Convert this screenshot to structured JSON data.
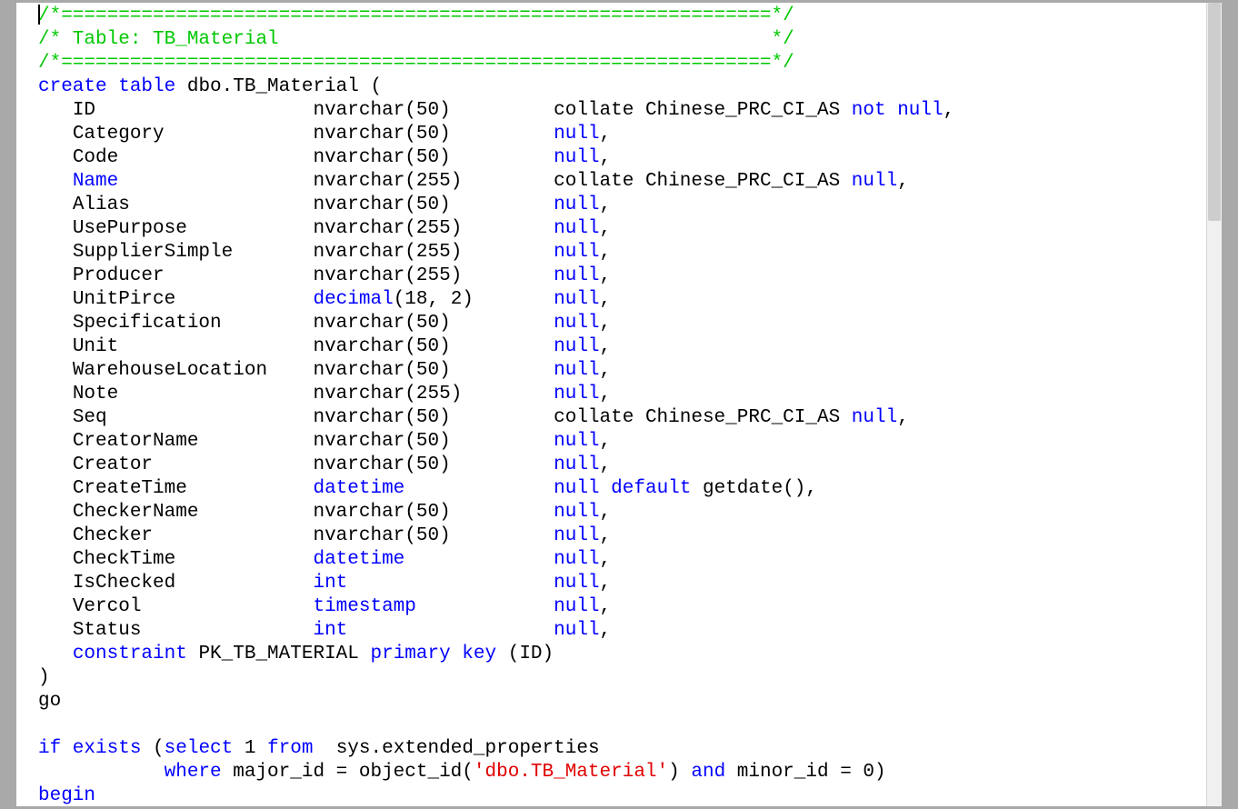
{
  "comment_bar": "/*==============================================================*/",
  "comment_title": "/* Table: TB_Material                                           */",
  "create_prefix": "create table",
  "create_name": " dbo.TB_Material (",
  "collate_text": "collate Chinese_PRC_CI_AS ",
  "kw_null": "null",
  "kw_notnull": "not null",
  "kw_default": "default",
  "kw_constraint": "constraint",
  "kw_pk": "primary key",
  "kw_decimal": "decimal",
  "kw_datetime": "datetime",
  "kw_int": "int",
  "kw_timestamp": "timestamp",
  "close_paren": ")",
  "go": "go",
  "if_exists_prefix": "if exists",
  "if_exists_mid1": " (",
  "kw_select": "select",
  "select_mid": " 1 ",
  "kw_from": "from",
  "from_trail": "  sys.extended_properties",
  "kw_where": "where",
  "where_mid": " major_id = object_id(",
  "str_dbo": "'dbo.TB_Material'",
  "where_trail1": ") ",
  "kw_and": "and",
  "where_trail2": " minor_id = 0)",
  "kw_begin": "begin",
  "getdate_trail": " getdate(),",
  "pk_name": " PK_TB_MATERIAL ",
  "pk_trail": " (ID)",
  "columns": [
    {
      "name": "ID",
      "type": "nvarchar(50)",
      "collate": true,
      "nullable": "not null",
      "comma": ","
    },
    {
      "name": "Category",
      "type": "nvarchar(50)",
      "collate": false,
      "nullable": "null",
      "comma": ","
    },
    {
      "name": "Code",
      "type": "nvarchar(50)",
      "collate": false,
      "nullable": "null",
      "comma": ","
    },
    {
      "name": "Name",
      "type": "nvarchar(255)",
      "collate": true,
      "nullable": "null",
      "comma": ",",
      "name_kw": true
    },
    {
      "name": "Alias",
      "type": "nvarchar(50)",
      "collate": false,
      "nullable": "null",
      "comma": ","
    },
    {
      "name": "UsePurpose",
      "type": "nvarchar(255)",
      "collate": false,
      "nullable": "null",
      "comma": ","
    },
    {
      "name": "SupplierSimple",
      "type": "nvarchar(255)",
      "collate": false,
      "nullable": "null",
      "comma": ","
    },
    {
      "name": "Producer",
      "type": "nvarchar(255)",
      "collate": false,
      "nullable": "null",
      "comma": ","
    },
    {
      "name": "UnitPirce",
      "type_kw": "decimal",
      "type_trail": "(18, 2)",
      "collate": false,
      "nullable": "null",
      "comma": ","
    },
    {
      "name": "Specification",
      "type": "nvarchar(50)",
      "collate": false,
      "nullable": "null",
      "comma": ","
    },
    {
      "name": "Unit",
      "type": "nvarchar(50)",
      "collate": false,
      "nullable": "null",
      "comma": ","
    },
    {
      "name": "WarehouseLocation",
      "type": "nvarchar(50)",
      "collate": false,
      "nullable": "null",
      "comma": ","
    },
    {
      "name": "Note",
      "type": "nvarchar(255)",
      "collate": false,
      "nullable": "null",
      "comma": ","
    },
    {
      "name": "Seq",
      "type": "nvarchar(50)",
      "collate": true,
      "nullable": "null",
      "comma": ","
    },
    {
      "name": "CreatorName",
      "type": "nvarchar(50)",
      "collate": false,
      "nullable": "null",
      "comma": ","
    },
    {
      "name": "Creator",
      "type": "nvarchar(50)",
      "collate": false,
      "nullable": "null",
      "comma": ","
    },
    {
      "name": "CreateTime",
      "type_kw": "datetime",
      "collate": false,
      "nullable": "null",
      "default": true
    },
    {
      "name": "CheckerName",
      "type": "nvarchar(50)",
      "collate": false,
      "nullable": "null",
      "comma": ","
    },
    {
      "name": "Checker",
      "type": "nvarchar(50)",
      "collate": false,
      "nullable": "null",
      "comma": ","
    },
    {
      "name": "CheckTime",
      "type_kw": "datetime",
      "collate": false,
      "nullable": "null",
      "comma": ","
    },
    {
      "name": "IsChecked",
      "type_kw": "int",
      "collate": false,
      "nullable": "null",
      "comma": ","
    },
    {
      "name": "Vercol",
      "type_kw": "timestamp",
      "collate": false,
      "nullable": "null",
      "comma": ","
    },
    {
      "name": "Status",
      "type_kw": "int",
      "collate": false,
      "nullable": "null",
      "comma": ","
    }
  ]
}
